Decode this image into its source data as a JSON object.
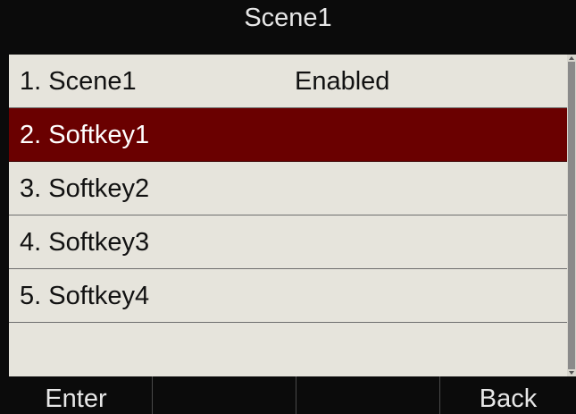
{
  "header": {
    "title": "Scene1"
  },
  "list": {
    "items": [
      {
        "label": "1. Scene1",
        "value": "Enabled"
      },
      {
        "label": "2. Softkey1",
        "value": ""
      },
      {
        "label": "3. Softkey2",
        "value": ""
      },
      {
        "label": "4. Softkey3",
        "value": ""
      },
      {
        "label": "5. Softkey4",
        "value": ""
      }
    ],
    "selected_index": 1
  },
  "softkeys": {
    "enter": "Enter",
    "key2": "",
    "key3": "",
    "back": "Back"
  },
  "colors": {
    "titlebar": "#0b0b0b",
    "background": "#e6e4dc",
    "selected": "#6a0000"
  }
}
